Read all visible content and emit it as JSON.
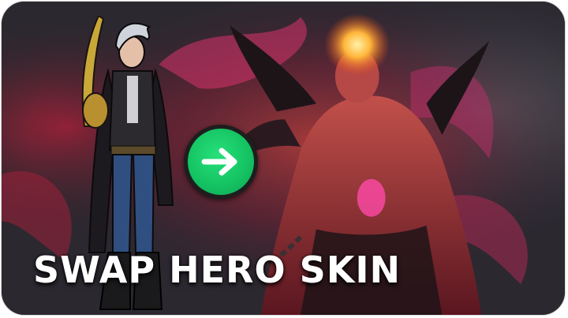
{
  "banner": {
    "title": "SWAP HERO SKIN",
    "title_color": "#ffffff",
    "accent_color": "#15c463"
  },
  "icons": {
    "swap": "arrow-right-icon"
  }
}
